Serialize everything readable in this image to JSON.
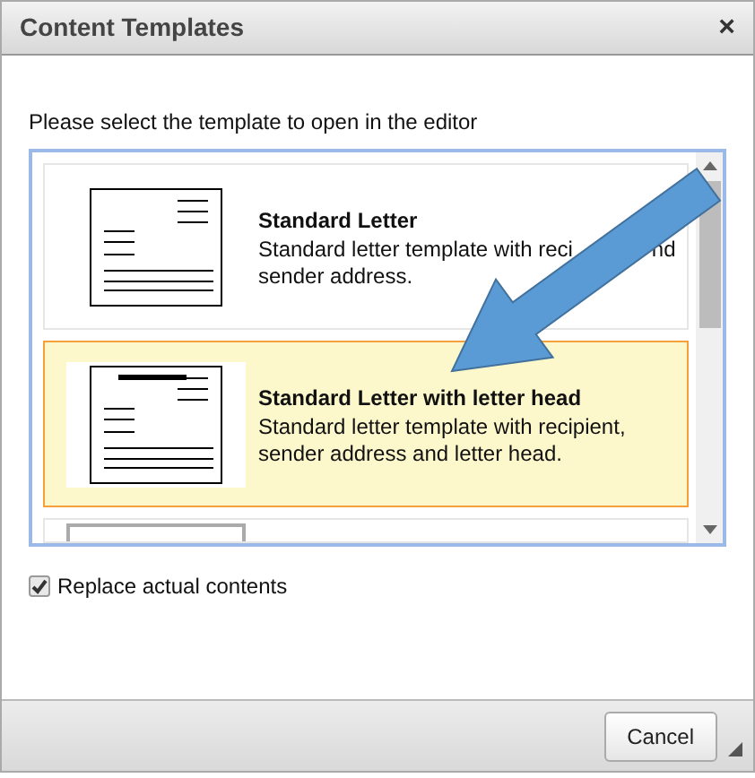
{
  "window": {
    "title": "Content Templates",
    "close": "×"
  },
  "instruction": "Please select the template to open in the editor",
  "templates": [
    {
      "title": "Standard Letter",
      "description_lines": [
        [
          "Standard letter template with reci",
          "nd"
        ],
        [
          "sender address."
        ]
      ],
      "letter_head": false,
      "selected": false
    },
    {
      "title": "Standard Letter with letter head",
      "description_lines": [
        [
          "Standard letter template with recipient,"
        ],
        [
          "sender address and letter head."
        ]
      ],
      "letter_head": true,
      "selected": true
    },
    {
      "selected": false,
      "letter_head": false
    }
  ],
  "replace_contents": {
    "label": "Replace actual contents",
    "checked": true
  },
  "buttons": [
    "Cancel"
  ]
}
